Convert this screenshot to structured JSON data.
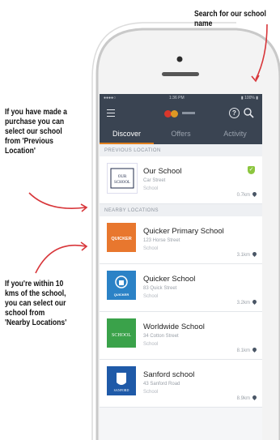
{
  "annotations": {
    "search": "Search for our school name",
    "previous": [
      "If you have made a",
      "purchase you can",
      "select our school",
      "from 'Previous",
      "Location'"
    ],
    "nearby": [
      "If you're within 10",
      "kms of the school,",
      "you can select our",
      "school from",
      "'Nearby Locations'"
    ]
  },
  "status_bar": {
    "carrier": "●●●●○ ",
    "time": "1:36 PM",
    "battery": "▮ 100% ▮"
  },
  "tabs": [
    {
      "label": "Discover",
      "active": true
    },
    {
      "label": "Offers",
      "active": false
    },
    {
      "label": "Activity",
      "active": false
    }
  ],
  "sections": {
    "previous_label": "PREVIOUS LOCATION",
    "nearby_label": "NEARBY LOCATIONS"
  },
  "previous_location": {
    "name": "Our School",
    "address": "Car Street",
    "type": "School",
    "distance": "0.7km"
  },
  "nearby_locations": [
    {
      "name": "Quicker Primary School",
      "address": "123 Horse Street",
      "type": "School",
      "distance": "3.1km",
      "thumb_color": "#e8772e",
      "thumb_text": "QUICKER"
    },
    {
      "name": "Quicker School",
      "address": "83 Quick Street",
      "type": "School",
      "distance": "3.2km",
      "thumb_color": "#2b82c6",
      "thumb_text": "QUICKER SCHOOL"
    },
    {
      "name": "Worldwide School",
      "address": "34 Cotton Street",
      "type": "School",
      "distance": "8.1km",
      "thumb_color": "#3aa24a",
      "thumb_text": "SCHOOL"
    },
    {
      "name": "Sanford school",
      "address": "43 Sanford Road",
      "type": "School",
      "distance": "8.9km",
      "thumb_color": "#1f5aa8",
      "thumb_text": "SANFORD SCHOOL"
    }
  ],
  "colors": {
    "header": "#3a4452",
    "accent": "#e07f1e",
    "arrow": "#d8363a",
    "verified": "#8cc63f"
  }
}
